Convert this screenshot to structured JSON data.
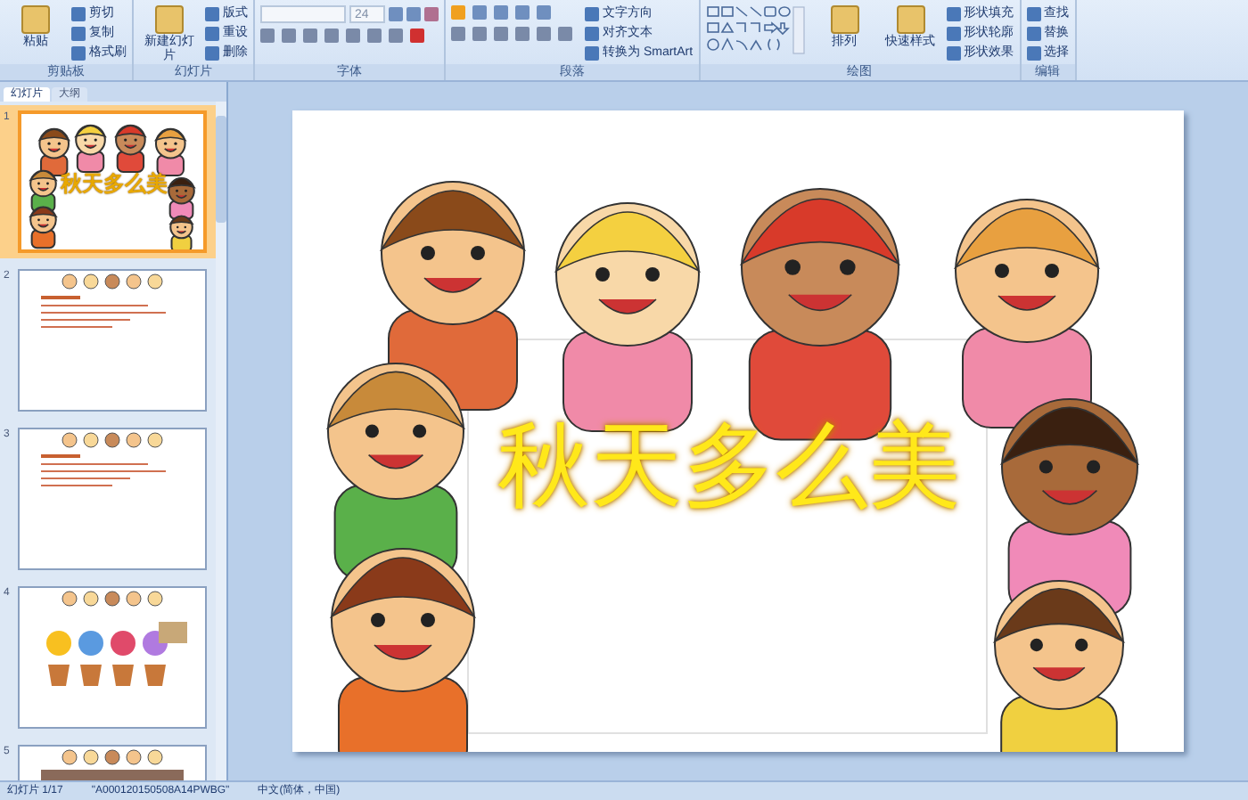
{
  "ribbon": {
    "groups": [
      {
        "label": "剪贴板",
        "items": [
          {
            "kind": "large",
            "label": "粘贴"
          },
          {
            "kind": "small",
            "label": "剪切"
          },
          {
            "kind": "small",
            "label": "复制"
          },
          {
            "kind": "small",
            "label": "格式刷"
          }
        ]
      },
      {
        "label": "幻灯片",
        "items": [
          {
            "kind": "large",
            "label": "新建幻灯片"
          },
          {
            "kind": "small",
            "label": "版式"
          },
          {
            "kind": "small",
            "label": "重设"
          },
          {
            "kind": "small",
            "label": "删除"
          }
        ]
      },
      {
        "label": "字体",
        "items": [
          {
            "kind": "fontsize",
            "label": "24"
          }
        ]
      },
      {
        "label": "段落",
        "items": [
          {
            "kind": "paragraph"
          },
          {
            "kind": "small",
            "label": "文字方向"
          },
          {
            "kind": "small",
            "label": "对齐文本"
          },
          {
            "kind": "small",
            "label": "转换为 SmartArt"
          }
        ]
      },
      {
        "label": "绘图",
        "items": [
          {
            "kind": "shapes"
          },
          {
            "kind": "large",
            "label": "排列"
          },
          {
            "kind": "large",
            "label": "快速样式"
          },
          {
            "kind": "small",
            "label": "形状填充"
          },
          {
            "kind": "small",
            "label": "形状轮廓"
          },
          {
            "kind": "small",
            "label": "形状效果"
          }
        ]
      },
      {
        "label": "编辑",
        "items": [
          {
            "kind": "small",
            "label": "查找"
          },
          {
            "kind": "small",
            "label": "替换"
          },
          {
            "kind": "small",
            "label": "选择"
          }
        ]
      }
    ]
  },
  "pane_tabs": [
    {
      "label": "幻灯片",
      "selected": true
    },
    {
      "label": "大纲",
      "selected": false
    }
  ],
  "slides": [
    {
      "number": "1",
      "kind": "title",
      "title": "秋天多么美",
      "selected": true
    },
    {
      "number": "2",
      "kind": "text",
      "selected": false
    },
    {
      "number": "3",
      "kind": "text",
      "selected": false
    },
    {
      "number": "4",
      "kind": "flowers",
      "selected": false
    },
    {
      "number": "5",
      "kind": "photo",
      "selected": false
    }
  ],
  "slide": {
    "title": "秋天多么美"
  },
  "status_bar": [
    "幻灯片 1/17",
    "\"A000120150508A14PWBG\"",
    "中文(简体，中国)"
  ]
}
